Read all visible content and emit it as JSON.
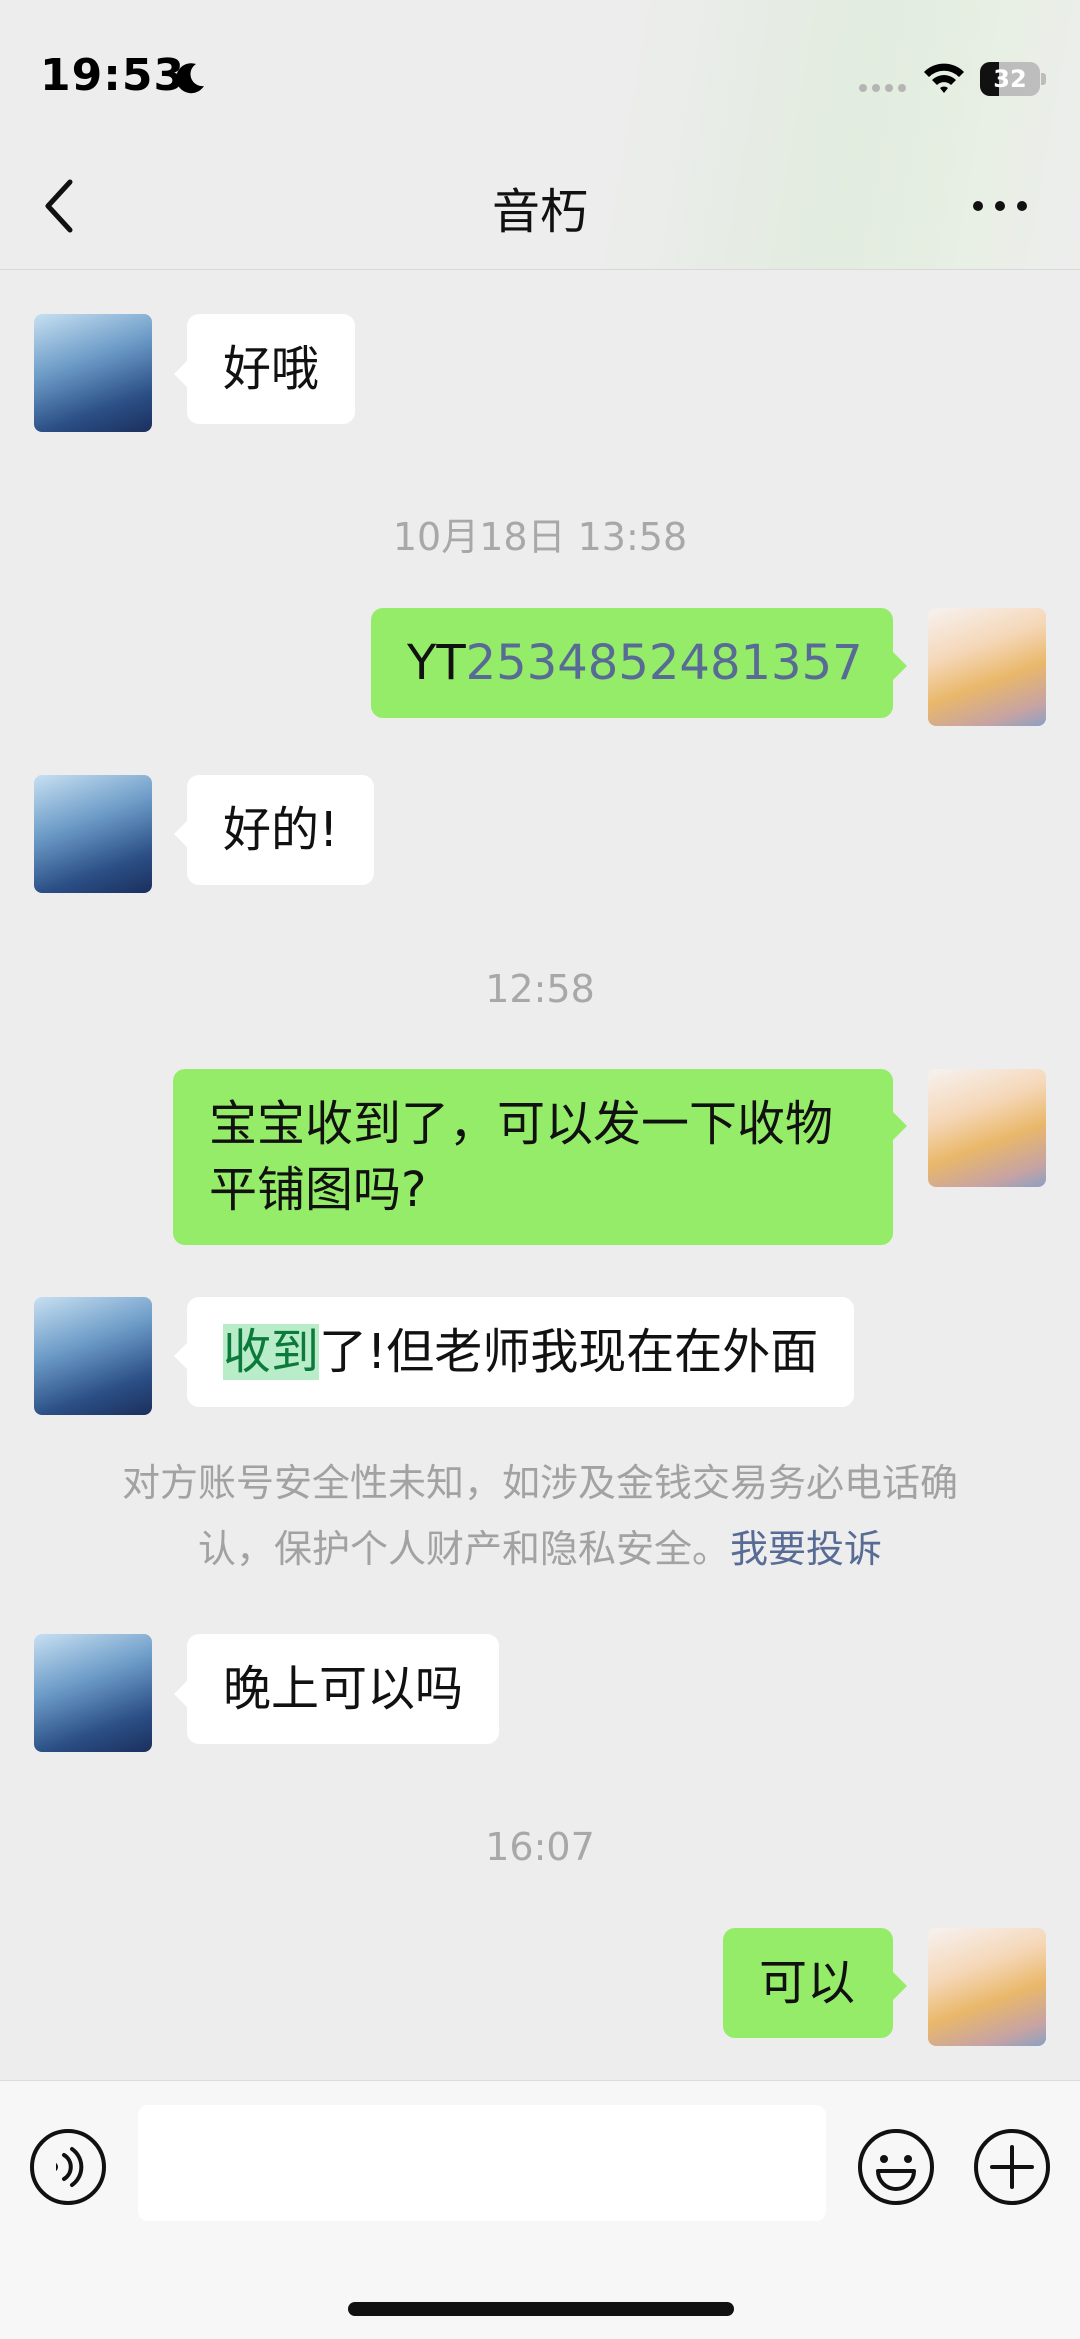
{
  "status_bar": {
    "time": "19:53",
    "battery_level": "32"
  },
  "nav": {
    "title": "音朽"
  },
  "messages": [
    {
      "side": "left",
      "text": "好哦"
    },
    {
      "timestamp": "10月18日 13:58"
    },
    {
      "side": "right",
      "prefix": "YT",
      "number": "2534852481357"
    },
    {
      "side": "left",
      "text": "好的!"
    },
    {
      "timestamp": "12:58"
    },
    {
      "side": "right",
      "line1": "宝宝收到了，可以发一下收物",
      "line2": "平铺图吗?"
    },
    {
      "side": "left",
      "highlight": "收到",
      "rest": "了!但老师我现在在外面"
    },
    {
      "notice_line1": "对方账号安全性未知，如涉及金钱交易务必电话确",
      "notice_line2": "认，保护个人财产和隐私安全。",
      "notice_link": "我要投诉"
    },
    {
      "side": "left",
      "text": "晚上可以吗"
    },
    {
      "timestamp": "16:07"
    },
    {
      "side": "right",
      "text": "可以"
    }
  ],
  "input_bar": {
    "placeholder": ""
  },
  "colors": {
    "background": "#ededed",
    "bubble_sent": "#95ec69",
    "bubble_received": "#ffffff",
    "link": "#576b95",
    "timestamp": "#a8a8a8"
  },
  "icons": [
    "moon-icon",
    "signal-icon",
    "wifi-icon",
    "battery-icon",
    "back-icon",
    "more-icon",
    "voice-icon",
    "emoji-icon",
    "plus-icon"
  ]
}
